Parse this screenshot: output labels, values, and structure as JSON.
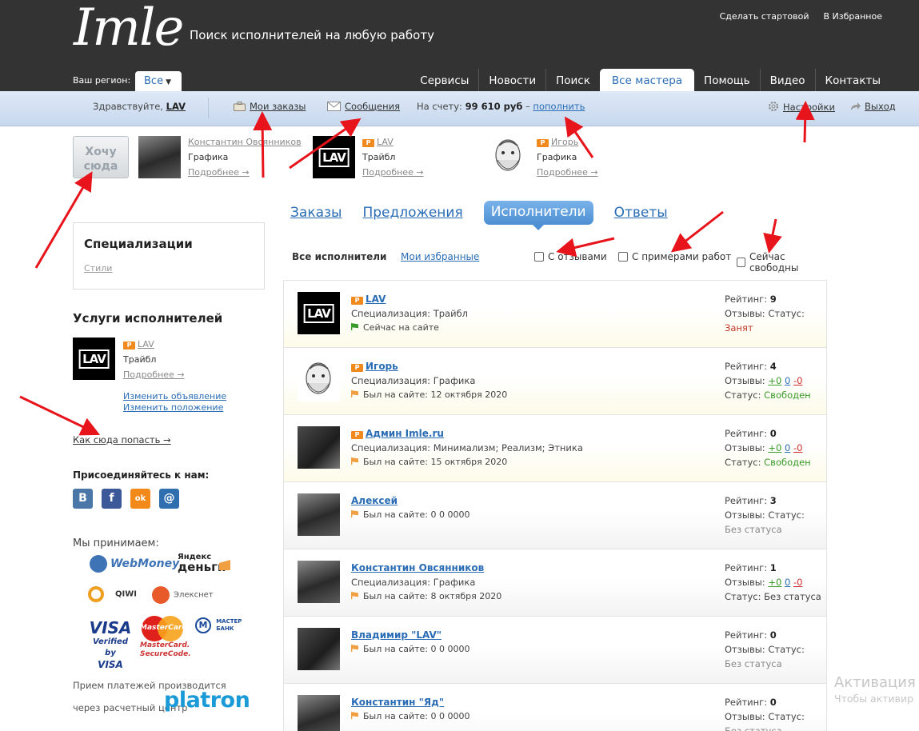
{
  "header": {
    "logo": "Imle",
    "tagline": "Поиск исполнителей на любую работу",
    "top_links": [
      "Сделать стартовой",
      "В Избранное"
    ],
    "region_label": "Ваш регион:",
    "region_value": "Все",
    "nav": [
      "Сервисы",
      "Новости",
      "Поиск",
      "Все мастера",
      "Помощь",
      "Видео",
      "Контакты"
    ],
    "nav_active": "Все мастера"
  },
  "userbar": {
    "greeting": "Здравствуйте,",
    "username": "LAV",
    "orders": "Мои заказы",
    "messages": "Сообщения",
    "balance_label": "На счету:",
    "balance": "99 610 руб",
    "dash": "–",
    "topup": "пополнить",
    "settings": "Настройки",
    "logout": "Выход"
  },
  "featured": {
    "want_line1": "Хочу",
    "want_line2": "сюда",
    "items": [
      {
        "name": "Константин Овсянников",
        "spec": "Графика",
        "more": "Подробнее →"
      },
      {
        "badge": "P",
        "name": "LAV",
        "spec": "Трайбл",
        "more": "Подробнее →"
      },
      {
        "badge": "P",
        "name": "Игорь",
        "spec": "Графика",
        "more": "Подробнее →"
      }
    ]
  },
  "sidebar": {
    "spec_title": "Специализации",
    "spec_link": "Стили",
    "services_title": "Услуги исполнителей",
    "service": {
      "badge": "P",
      "name": "LAV",
      "spec": "Трайбл",
      "more": "Подробнее →"
    },
    "edit_ad": "Изменить объявление",
    "edit_pos": "Изменить положение",
    "how_link": "Как сюда попасть →",
    "join_title": "Присоединяйтесь к нам:",
    "social": [
      "В",
      "f",
      "ok",
      "@"
    ],
    "pay_title": "Мы принимаем:",
    "pay_logos": {
      "webmoney": "WebMoney",
      "yandex_top": "Яндекс",
      "yandex_bottom": "деньги",
      "qiwi": "QIWI",
      "eleksnet": "Элекснет",
      "visa": "VISA",
      "visa_verified1": "Verified by",
      "visa_verified2": "VISA",
      "mastercard": "MasterCard",
      "mc_secure1": "MasterCard.",
      "mc_secure2": "SecureCode.",
      "masterbank1": "МАСТЕР",
      "masterbank2": "БАНК"
    },
    "pay_note": "Прием платежей производится через расчетный центр",
    "platron": "platron"
  },
  "tabs": [
    "Заказы",
    "Предложения",
    "Исполнители",
    "Ответы"
  ],
  "tab_active": "Исполнители",
  "filters": {
    "all": "Все исполнители",
    "fav": "Мои избранные",
    "checks": [
      "С отзывами",
      "С примерами работ",
      "Сейчас свободны"
    ]
  },
  "labels": {
    "spec": "Специализация:",
    "rating": "Рейтинг:",
    "reviews": "Отзывы:",
    "status": "Статус:"
  },
  "rows": [
    {
      "pro": true,
      "name": "LAV",
      "spec": "Трайбл",
      "seen": "Сейчас на сайте",
      "online": true,
      "rating": "9",
      "reviews": null,
      "status": "Занят",
      "status_kind": "busy"
    },
    {
      "pro": true,
      "name": "Игорь",
      "spec": "Графика",
      "seen": "Был на сайте: 12 октября 2020",
      "rating": "4",
      "reviews": [
        "+0",
        "0",
        "-0"
      ],
      "status": "Свободен",
      "status_kind": "free"
    },
    {
      "pro": true,
      "name": "Админ Imle.ru",
      "spec": "Минимализм; Реализм; Этника",
      "seen": "Был на сайте: 15 октября 2020",
      "rating": "0",
      "reviews": [
        "+0",
        "0",
        "-0"
      ],
      "status": "Свободен",
      "status_kind": "free"
    },
    {
      "pro": false,
      "name": "Алексей",
      "spec": null,
      "seen": "Был на сайте: 0 0 0000",
      "rating": "3",
      "reviews": null,
      "status": "Без статуса",
      "status_kind": "none"
    },
    {
      "pro": false,
      "name": "Константин Овсянников",
      "spec": "Графика",
      "seen": "Был на сайте: 8 октября 2020",
      "rating": "1",
      "reviews": [
        "+0",
        "0",
        "-0"
      ],
      "status": "Без статуса",
      "status_kind": "none-inline"
    },
    {
      "pro": false,
      "name": "Владимир \"LAV\"",
      "spec": null,
      "seen": "Был на сайте: 0 0 0000",
      "rating": "0",
      "reviews": null,
      "status": "Без статуса",
      "status_kind": "none"
    },
    {
      "pro": false,
      "name": "Константин \"Яд\"",
      "spec": null,
      "seen": "Был на сайте: 0 0 0000",
      "rating": "0",
      "reviews": null,
      "status": "Без статуса",
      "status_kind": "none"
    }
  ],
  "watermark": {
    "line1": "Активация W",
    "line2": "Чтобы активир"
  },
  "colors": {
    "header_bg": "#333333",
    "link": "#2a6db5",
    "accent_tab": "#4d8fd3",
    "free": "#3a9a2a",
    "busy": "#c0392b",
    "arrow": "#e8141b"
  }
}
